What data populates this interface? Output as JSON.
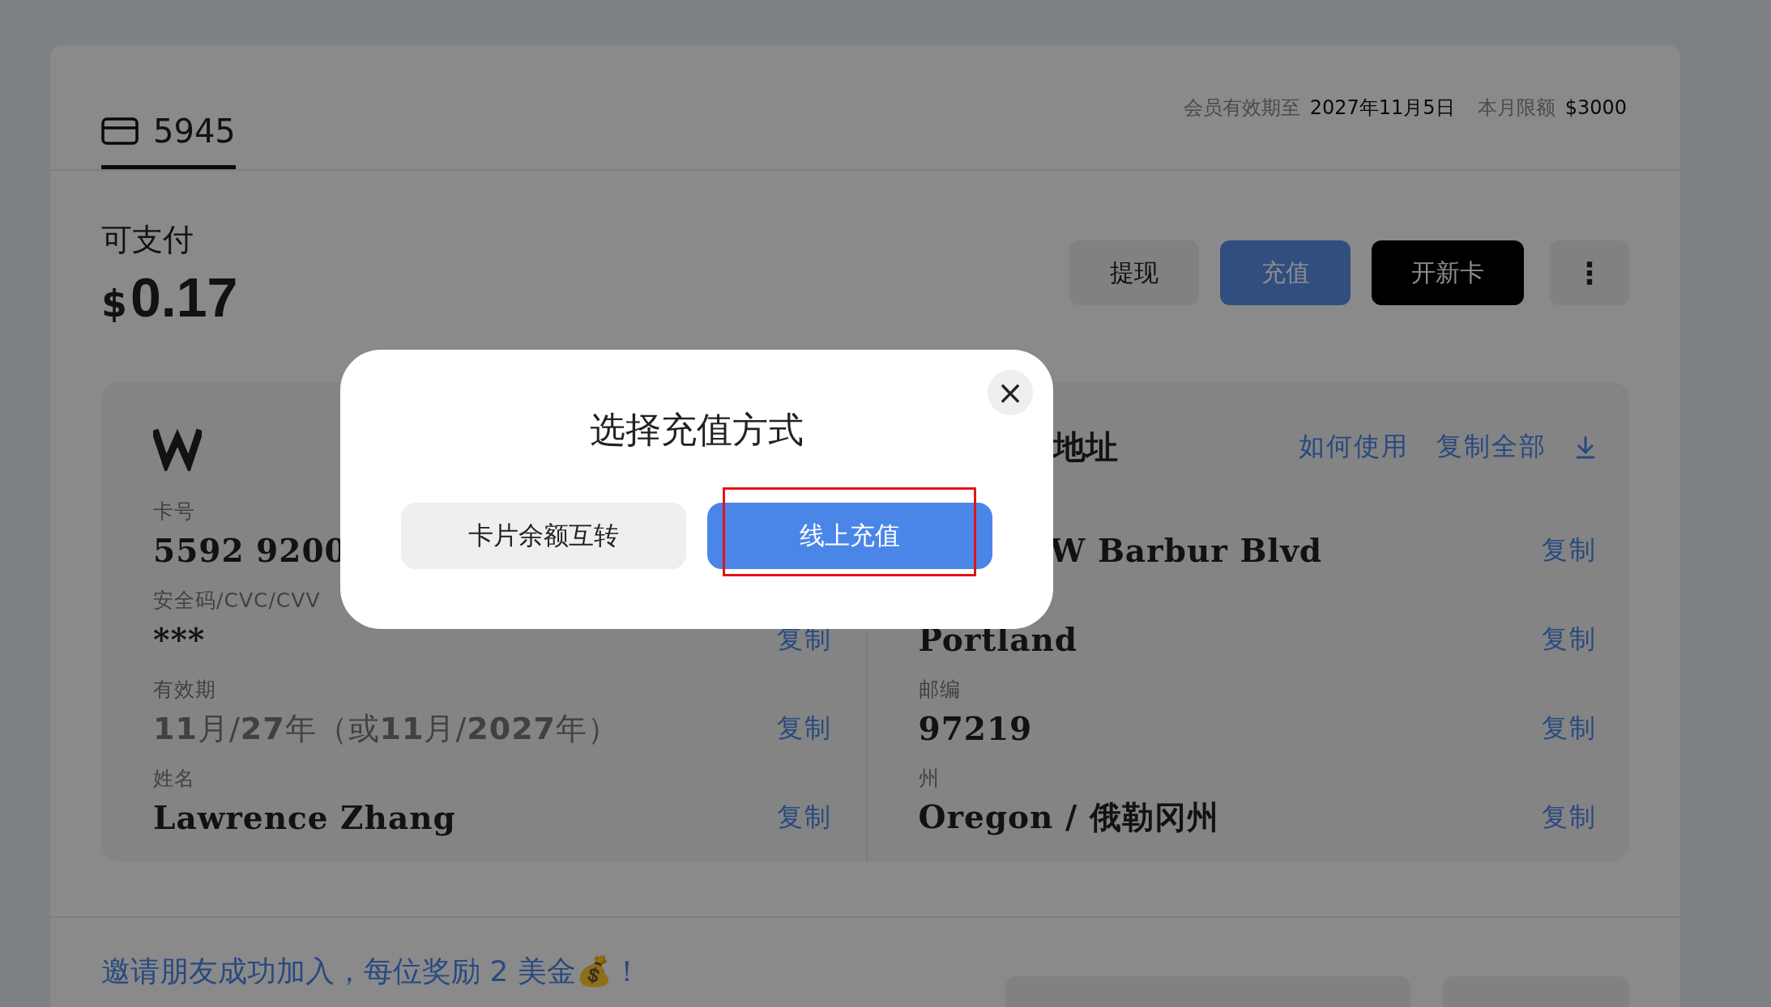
{
  "header": {
    "tab": {
      "label": "5945",
      "selected": true
    },
    "expiry_label": "会员有效期至",
    "expiry_value": "2027年11月5日",
    "limit_label": "本月限额",
    "limit_value": "$3000"
  },
  "balance": {
    "label": "可支付",
    "currency": "$",
    "amount": "0.17"
  },
  "actions": [
    {
      "label": "提现",
      "kind": "plain"
    },
    {
      "label": "充值",
      "kind": "primary"
    },
    {
      "label": "开新卡",
      "kind": "dark"
    },
    {
      "label": "⋮",
      "kind": "more"
    }
  ],
  "card_info": {
    "rows": [
      {
        "label": "卡号",
        "value": "5592 9200"
      },
      {
        "label": "安全码/CVC/CVV",
        "value": "***",
        "copy": "复制"
      },
      {
        "label": "有效期",
        "value": "**11**月/**27**年（或**11**月/**2027**年）",
        "copy": "复制"
      },
      {
        "label": "姓名",
        "value": "Lawrence Zhang",
        "copy": "复制"
      }
    ]
  },
  "address": {
    "title": "地址",
    "links": [
      "如何使用",
      "复制全部"
    ],
    "rows": [
      {
        "value": "W Barbur Blvd",
        "copy": "复制"
      },
      {
        "value": "Portland",
        "copy": "复制"
      },
      {
        "label": "邮编",
        "value": "97219",
        "copy": "复制"
      },
      {
        "label": "州",
        "value": "Oregon / 俄勒冈州",
        "copy": "复制"
      }
    ]
  },
  "invite": {
    "text": "邀请朋友成功加入，每位奖励 2 美金💰！"
  },
  "dialog": {
    "title": "选择充值方式",
    "close": "×",
    "options": [
      {
        "label": "卡片余额互转",
        "kind": "secondary",
        "highlighted": false
      },
      {
        "label": "线上充值",
        "kind": "primary",
        "highlighted": true
      }
    ]
  }
}
